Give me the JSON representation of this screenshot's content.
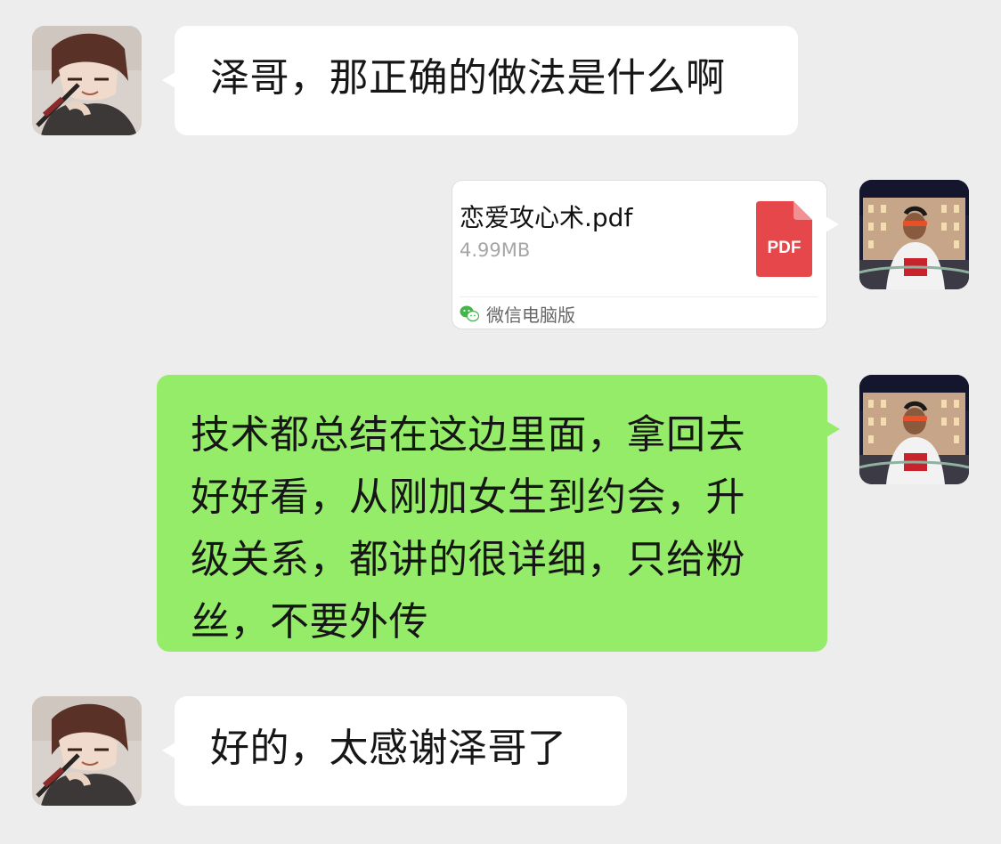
{
  "messages": [
    {
      "side": "left",
      "text": "泽哥，那正确的做法是什么啊"
    },
    {
      "side": "right",
      "type": "file",
      "file": {
        "name": "恋爱攻心术.pdf",
        "size": "4.99MB",
        "badge": "PDF",
        "source": "微信电脑版",
        "source_icon": "wechat-icon"
      }
    },
    {
      "side": "right",
      "lines": [
        "技术都总结在这边里面，拿回去",
        "好好看，从刚加女生到约会，升",
        "级关系，都讲的很详细，只给粉",
        "丝，不要外传"
      ]
    },
    {
      "side": "left",
      "text": "好的，太感谢泽哥了"
    }
  ],
  "colors": {
    "background": "#ededed",
    "bubble_received": "#ffffff",
    "bubble_sent": "#95ec69",
    "pdf_icon": "#e5474b",
    "wechat_green": "#44b549"
  }
}
